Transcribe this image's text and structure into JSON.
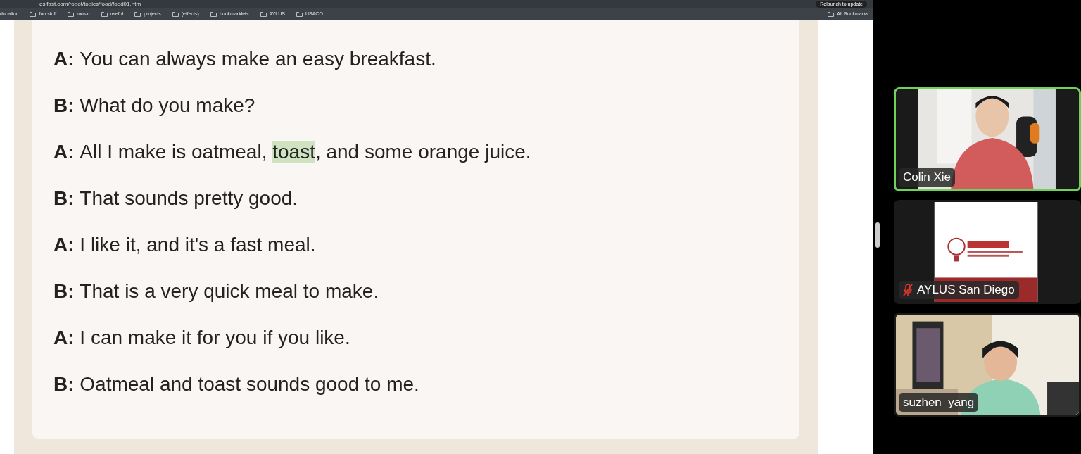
{
  "browser": {
    "url": "eslfast.com/robot/topics/food/food01.htm",
    "update_button": "Relaunch to update",
    "bookmarks": [
      "ducation",
      "fun stuff",
      "music",
      "useful",
      "projects",
      "(effects)",
      "bookmarklets",
      "AYLUS",
      "USACO"
    ],
    "all_bookmarks": "All Bookmarks"
  },
  "dialogue": [
    {
      "speaker": "A:",
      "parts": [
        {
          "text": "You can always make an easy breakfast.",
          "highlighted": false
        }
      ]
    },
    {
      "speaker": "B:",
      "parts": [
        {
          "text": "What do you make?",
          "highlighted": false
        }
      ]
    },
    {
      "speaker": "A:",
      "parts": [
        {
          "text": "All I make is oatmeal, ",
          "highlighted": false
        },
        {
          "text": "toast",
          "highlighted": true
        },
        {
          "text": ", and some orange juice.",
          "highlighted": false
        }
      ]
    },
    {
      "speaker": "B:",
      "parts": [
        {
          "text": "That sounds pretty good.",
          "highlighted": false
        }
      ]
    },
    {
      "speaker": "A:",
      "parts": [
        {
          "text": "I like it, and it's a fast meal.",
          "highlighted": false
        }
      ]
    },
    {
      "speaker": "B:",
      "parts": [
        {
          "text": "That is a very quick meal to make.",
          "highlighted": false
        }
      ]
    },
    {
      "speaker": "A:",
      "parts": [
        {
          "text": "I can make it for you if you like.",
          "highlighted": false
        }
      ]
    },
    {
      "speaker": "B:",
      "parts": [
        {
          "text": "Oatmeal and toast sounds good to me.",
          "highlighted": false
        }
      ]
    }
  ],
  "participants": [
    {
      "name": "Colin Xie",
      "speaking": true,
      "muted": false,
      "kind": "person"
    },
    {
      "name": "AYLUS San Diego",
      "speaking": false,
      "muted": true,
      "kind": "slide"
    },
    {
      "name": "suzhen  yang",
      "speaking": false,
      "muted": false,
      "kind": "room"
    }
  ]
}
